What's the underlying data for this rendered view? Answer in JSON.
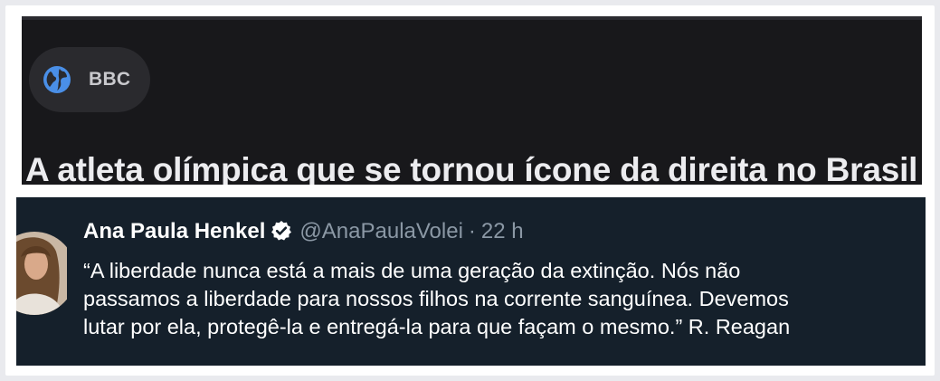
{
  "news_card": {
    "source_icon": "globe-icon",
    "source_name": "BBC",
    "headline": "A atleta olímpica que se tornou ícone da direita no Brasil -"
  },
  "tweet": {
    "author_name": "Ana Paula Henkel",
    "verified_icon": "verified-badge-icon",
    "handle": "@AnaPaulaVolei",
    "separator": "·",
    "time": "22 h",
    "text_lines": [
      "“A liberdade nunca está a mais de uma geração da extinção. Nós não",
      "passamos a liberdade para nossos filhos na corrente sanguínea. Devemos",
      "lutar por ela, protegê-la e entregá-la para que façam o mesmo.” R. Reagan"
    ]
  },
  "colors": {
    "news_bg": "#18181b",
    "tweet_bg": "#15202b",
    "globe_blue": "#4a8fe7"
  }
}
